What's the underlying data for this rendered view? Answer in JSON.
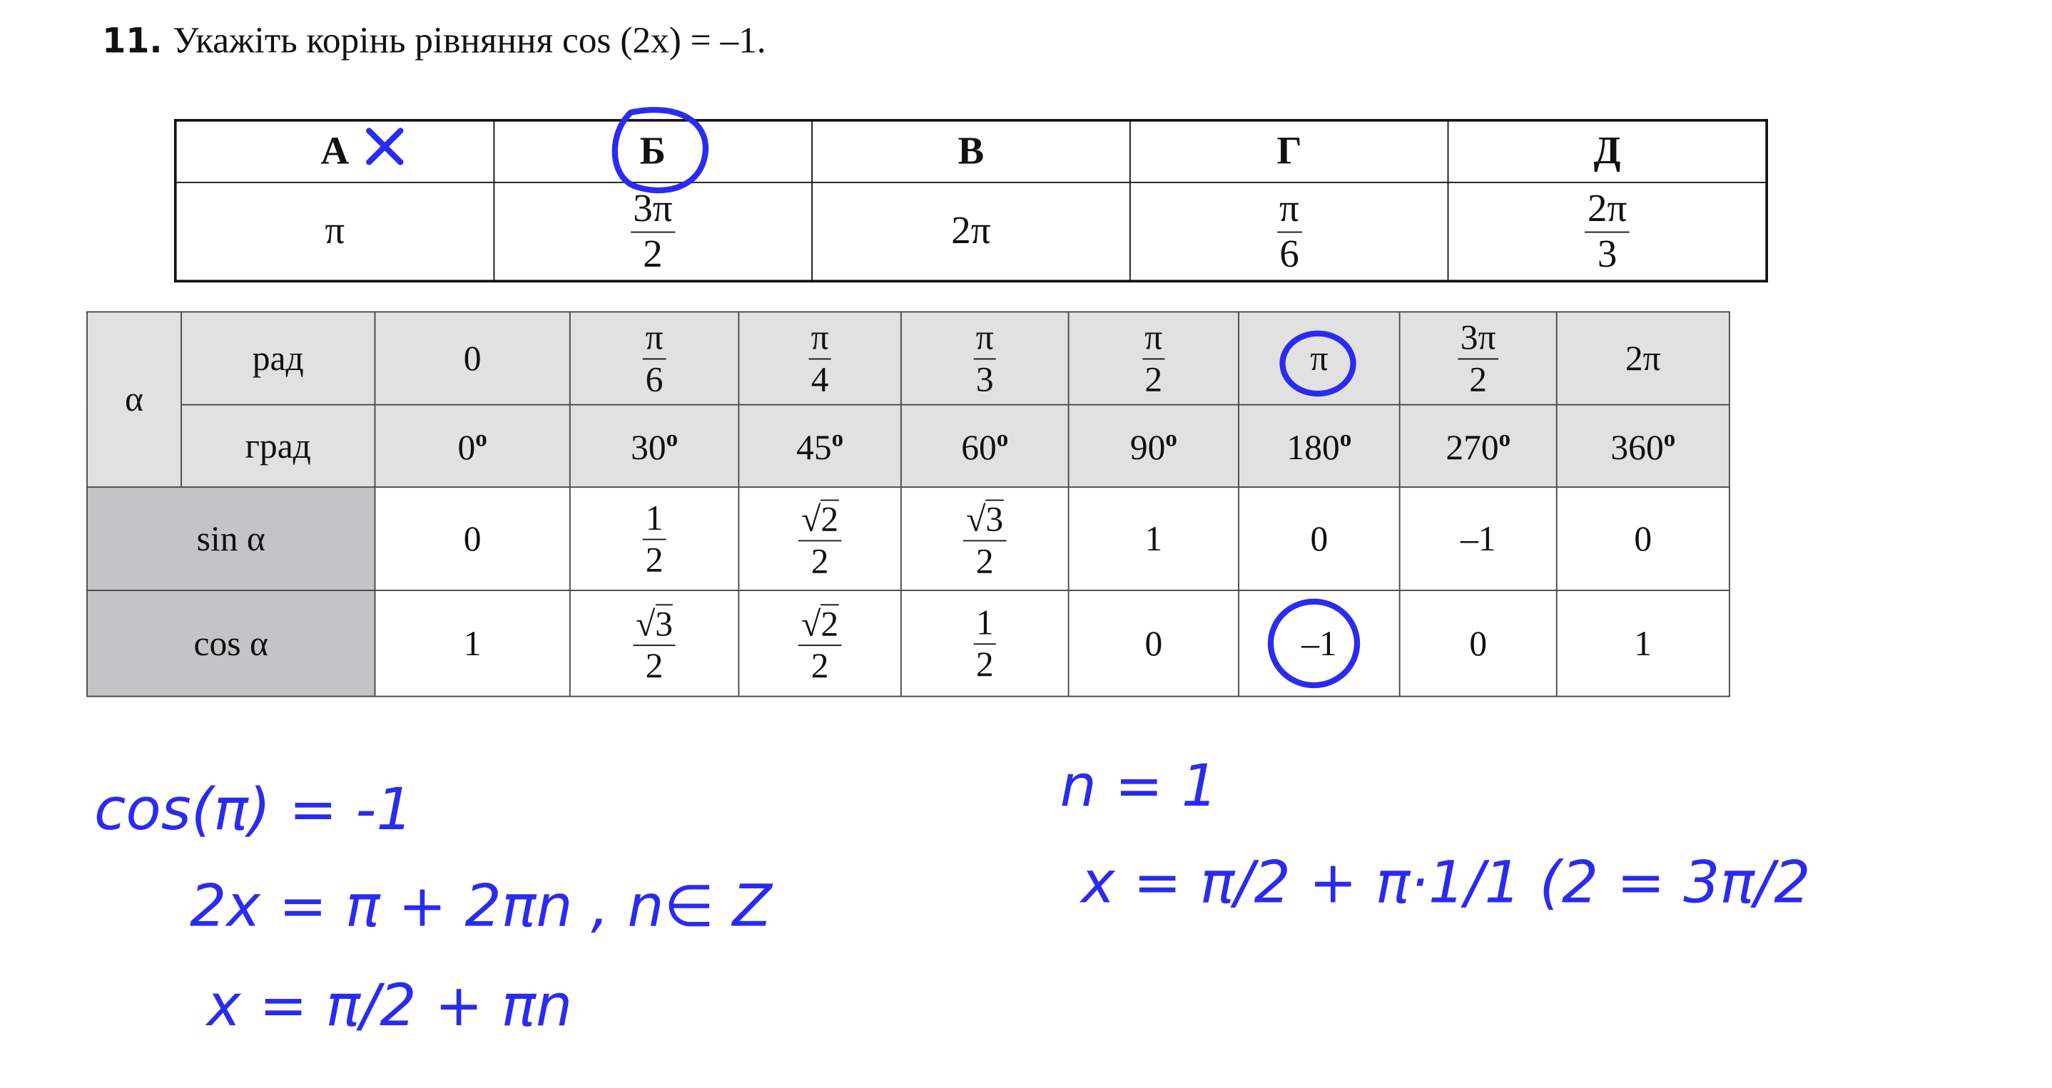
{
  "task": {
    "number": "11.",
    "text": "Укажіть корінь рівняння cos (2x) = –1."
  },
  "answers": {
    "letters": [
      "А",
      "Б",
      "В",
      "Г",
      "Д"
    ],
    "values": {
      "a": "π",
      "b": {
        "num": "3π",
        "den": "2"
      },
      "c": "2π",
      "d": {
        "num": "π",
        "den": "6"
      },
      "e": {
        "num": "2π",
        "den": "3"
      }
    }
  },
  "trig": {
    "alpha": "α",
    "rad_label": "рад",
    "deg_label": "град",
    "rad": [
      "0",
      "π/6",
      "π/4",
      "π/3",
      "π/2",
      "π",
      "3π/2",
      "2π"
    ],
    "deg": [
      "0",
      "30",
      "45",
      "60",
      "90",
      "180",
      "270",
      "360"
    ],
    "deg_sign": "о",
    "sin_label": "sin α",
    "cos_label": "cos α",
    "sin": [
      "0",
      "1/2",
      "√2/2",
      "√3/2",
      "1",
      "0",
      "–1",
      "0"
    ],
    "cos": [
      "1",
      "√3/2",
      "√2/2",
      "1/2",
      "0",
      "–1",
      "0",
      "1"
    ]
  },
  "handwriting": {
    "line1": "cos(π) = -1",
    "line2": "2x = π + 2πn , n∈ Z",
    "line3": "x = π/2 + πn",
    "line4": "n = 1",
    "line5": "x = π/2 + π·1/1 (2 = 3π/2"
  },
  "ink_color": "#2b2bf0"
}
